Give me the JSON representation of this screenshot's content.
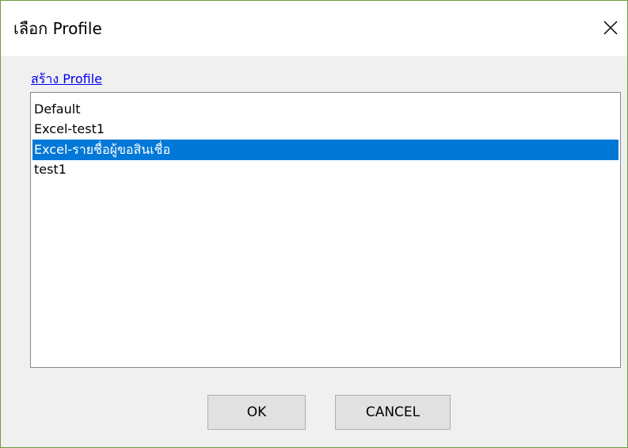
{
  "window": {
    "title": "เลือก Profile",
    "close_icon": "close-icon"
  },
  "create_link": "สร้าง Profile",
  "profiles": [
    {
      "label": "Default",
      "selected": false
    },
    {
      "label": "Excel-test1",
      "selected": false
    },
    {
      "label": "Excel-รายชื่อผู้ขอสินเชื่อ",
      "selected": true
    },
    {
      "label": "test1",
      "selected": false
    }
  ],
  "buttons": {
    "ok_label": "OK",
    "cancel_label": "CANCEL"
  },
  "colors": {
    "selection": "#0078d7",
    "link": "#0000ee",
    "border_accent": "#6f9b3f"
  }
}
